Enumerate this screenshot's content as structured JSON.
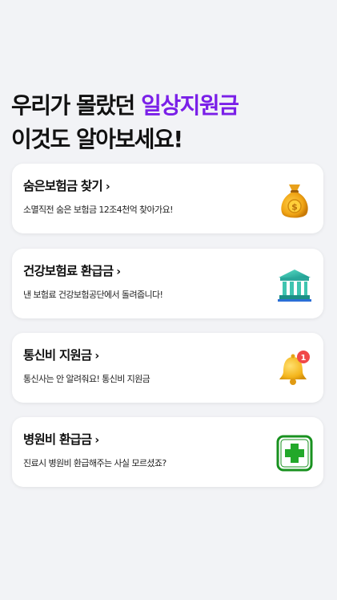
{
  "header": {
    "line1_prefix": "우리가 몰랐던 ",
    "line1_accent": "일상지원금",
    "line2": "이것도 알아보세요!",
    "accent_color": "#7a1fe8"
  },
  "cards": [
    {
      "title": "숨은보험금 찾기",
      "chevron": "›",
      "description": "소멸직전 숨은 보험금 12조4천억 찾아가요!",
      "icon": "money-bag-icon"
    },
    {
      "title": "건강보험료 환급금",
      "chevron": "›",
      "description": "낸 보험료 건강보험공단에서 돌려줍니다!",
      "icon": "bank-building-icon"
    },
    {
      "title": "통신비 지원금",
      "chevron": "›",
      "description": "통신사는 안 알려줘요! 통신비 지원금",
      "icon": "notification-bell-icon",
      "badge": "1"
    },
    {
      "title": "병원비 환급금",
      "chevron": "›",
      "description": "진료시 병원비 환급해주는 사실 모르셨죠?",
      "icon": "medical-cross-icon"
    }
  ]
}
